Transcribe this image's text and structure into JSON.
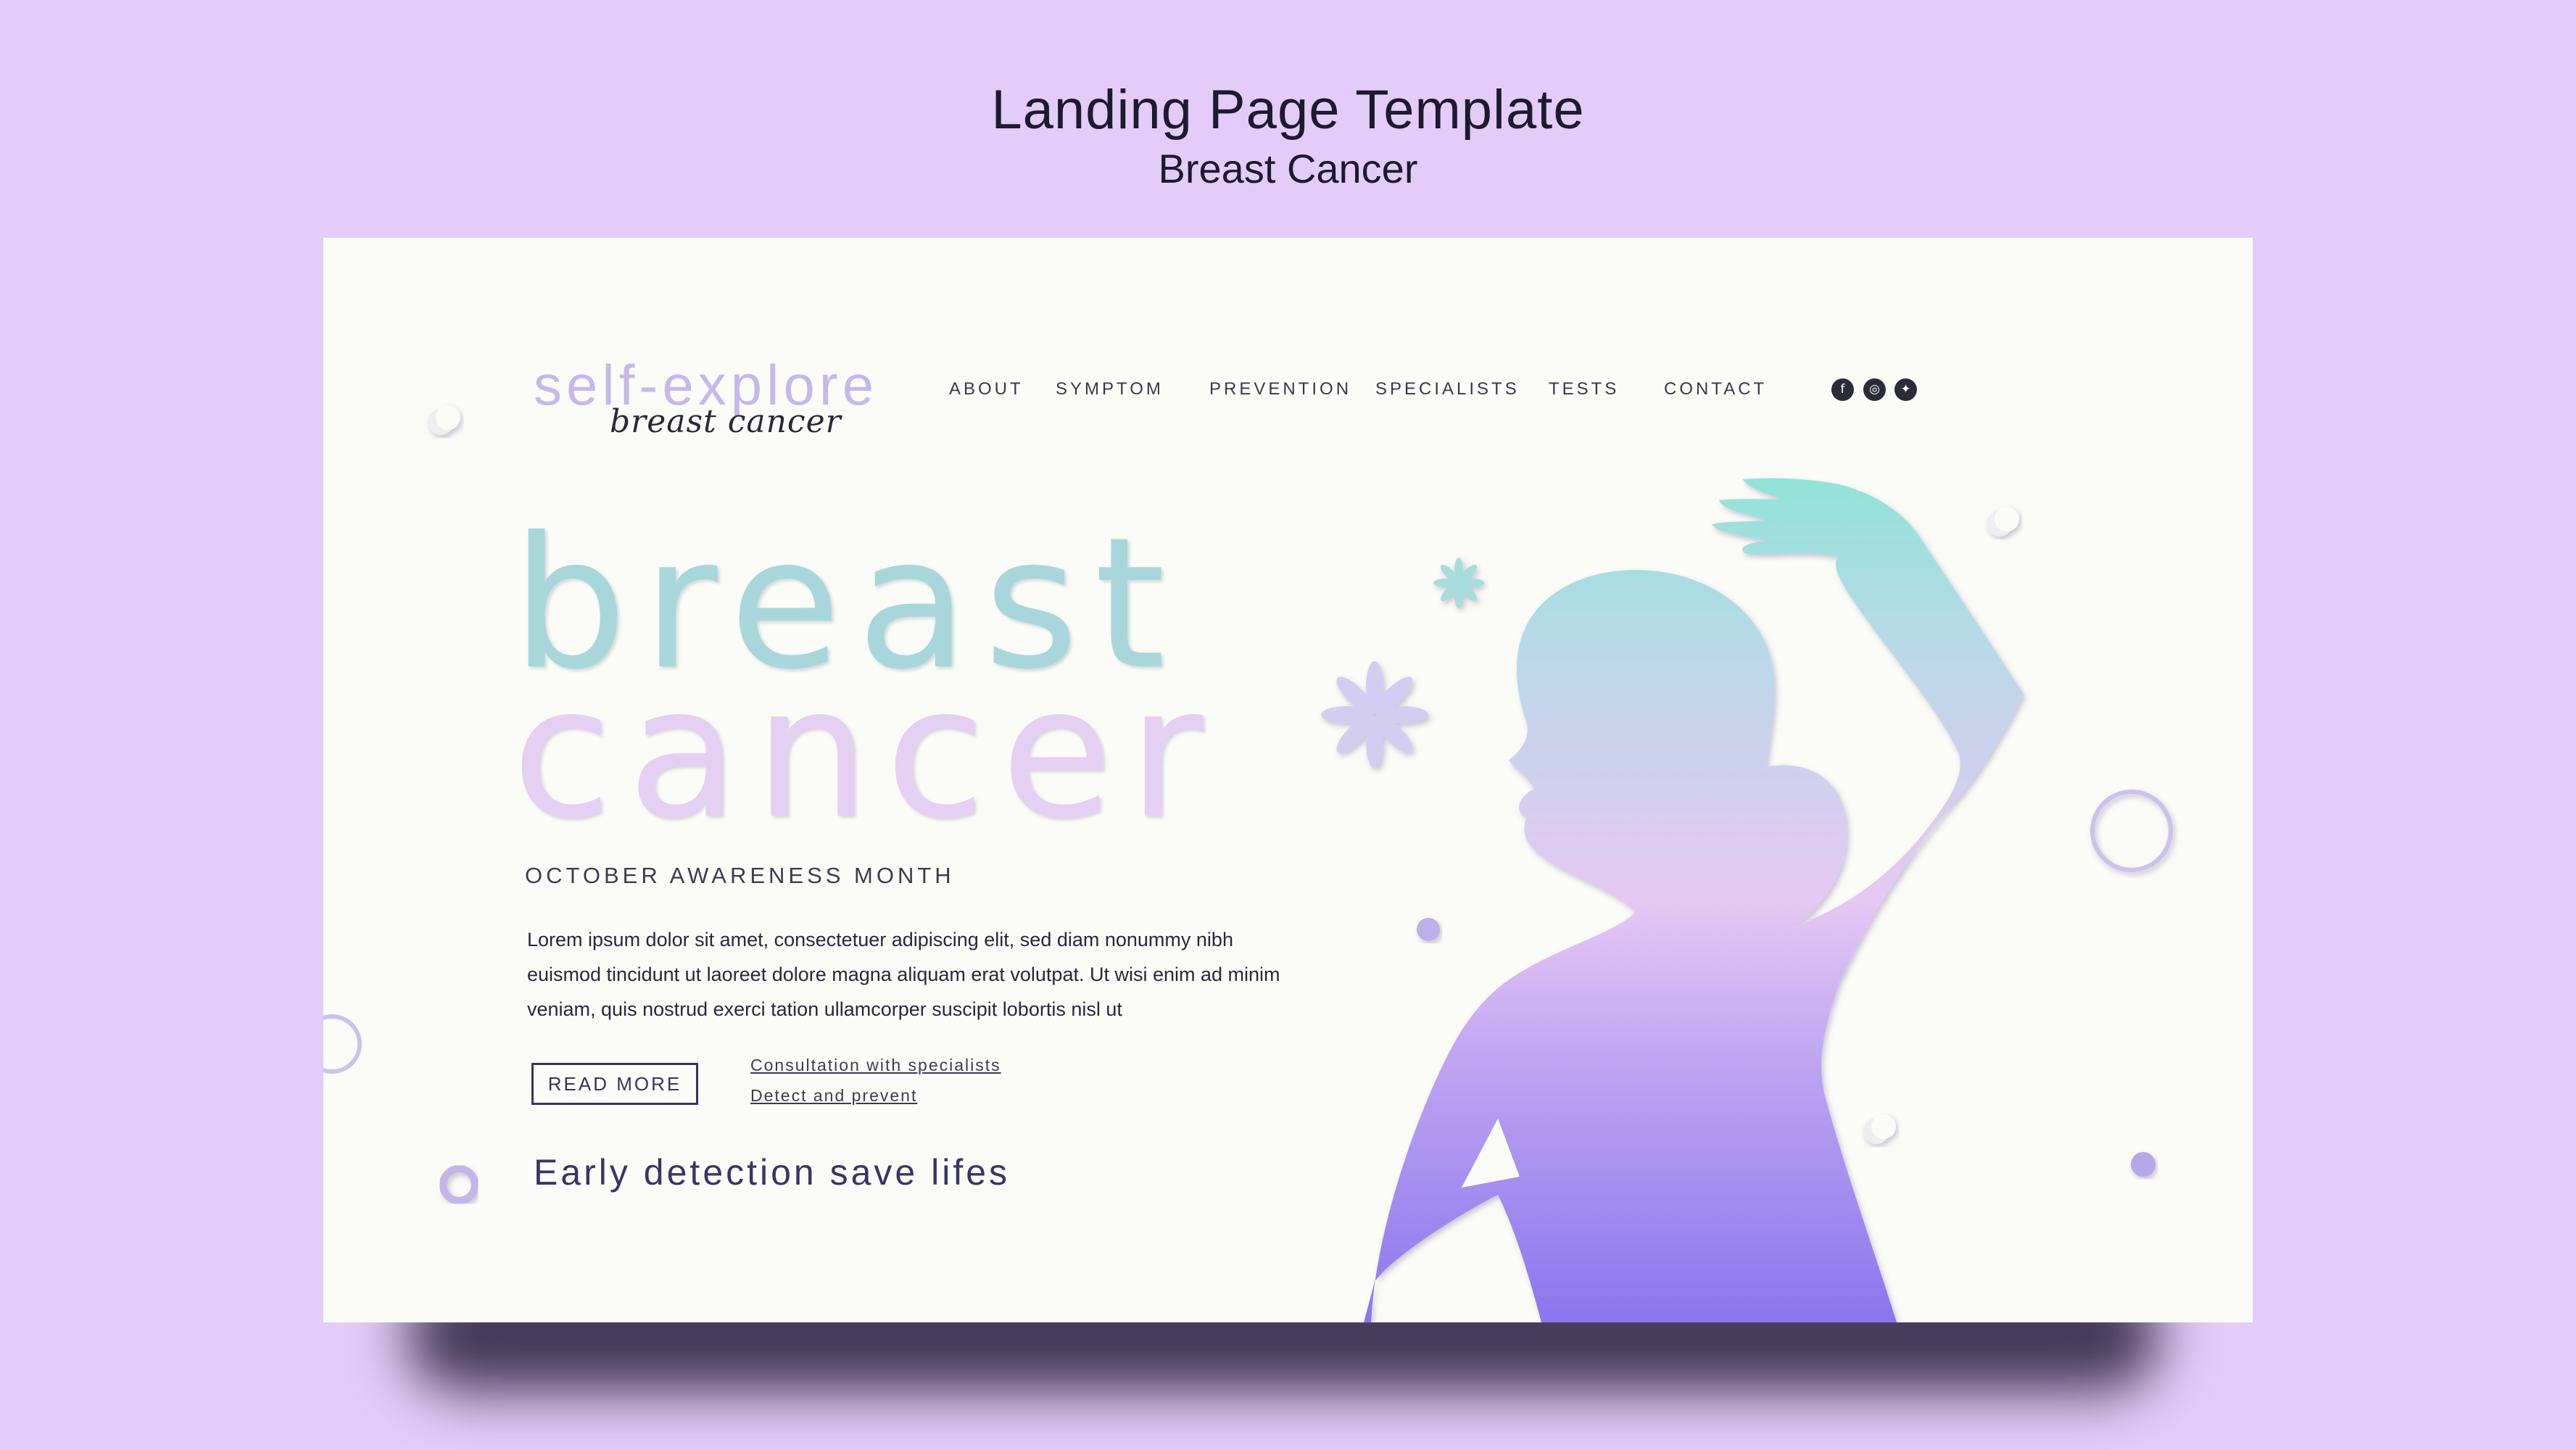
{
  "header": {
    "title": "Landing Page Template",
    "subtitle": "Breast Cancer"
  },
  "logo": {
    "main": "self-explore",
    "script": "breast cancer"
  },
  "nav": {
    "items": [
      "ABOUT",
      "SYMPTOM",
      "PREVENTION",
      "SPECIALISTS",
      "TESTS",
      "CONTACT"
    ]
  },
  "social": {
    "icons": [
      "facebook-icon",
      "instagram-icon",
      "twitter-icon"
    ],
    "glyphs": [
      "f",
      "◎",
      "✦"
    ]
  },
  "hero": {
    "line1": "breast",
    "line2": "cancer",
    "kicker": "OCTOBER AWARENESS MONTH",
    "body": "Lorem ipsum dolor sit amet, consectetuer adipiscing elit, sed diam nonummy nibh euismod tincidunt ut  laoreet dolore magna aliquam erat volutpat. Ut wisi enim ad minim veniam, quis nostrud exerci tation ullamcorper suscipit lobortis nisl ut",
    "cta": "READ MORE",
    "links": [
      "Consultation with specialists",
      "Detect and prevent"
    ],
    "tagline": "Early detection save lifes"
  },
  "colors": {
    "background": "#e3ccf8",
    "page": "#fbfcf7",
    "teal": "#a7d7db",
    "lavender": "#c4b8ec",
    "violet": "#8c78ee",
    "ink": "#3a3468"
  }
}
